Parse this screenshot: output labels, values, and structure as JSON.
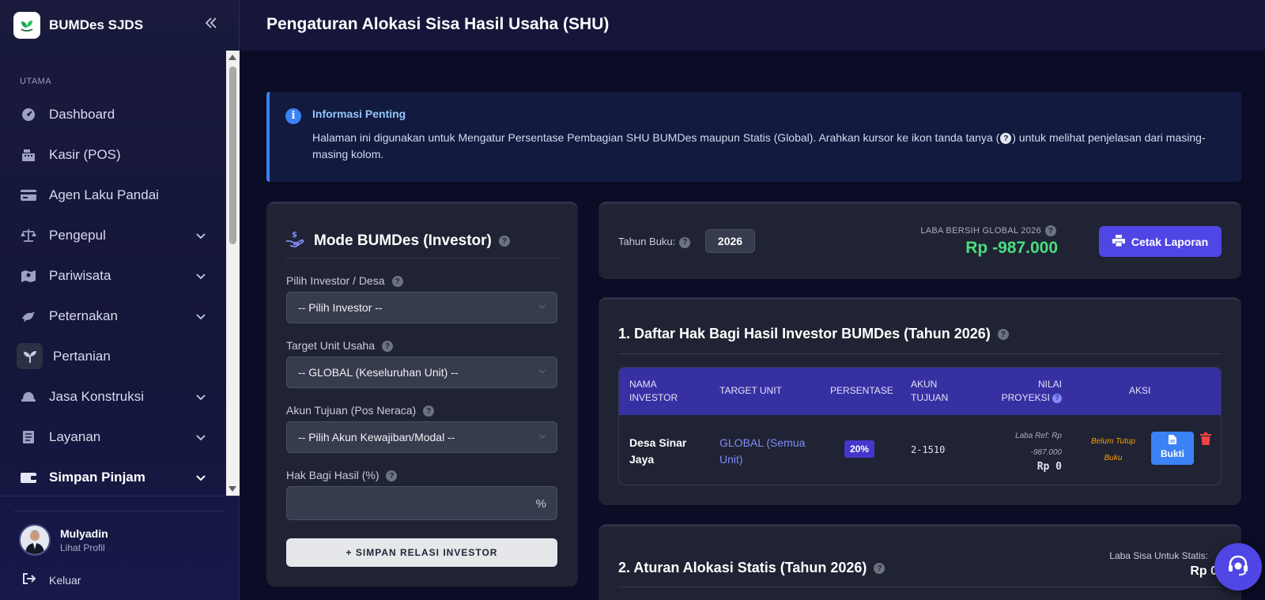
{
  "brand": {
    "name": "BUMDes SJDS"
  },
  "sidebar": {
    "section": "UTAMA",
    "items": [
      {
        "label": "Dashboard",
        "icon": "gauge-icon",
        "chevron": false
      },
      {
        "label": "Kasir (POS)",
        "icon": "cash-register-icon",
        "chevron": false
      },
      {
        "label": "Agen Laku Pandai",
        "icon": "credit-card-icon",
        "chevron": false
      },
      {
        "label": "Pengepul",
        "icon": "scale-icon",
        "chevron": true
      },
      {
        "label": "Pariwisata",
        "icon": "map-icon",
        "chevron": true
      },
      {
        "label": "Peternakan",
        "icon": "bird-icon",
        "chevron": true
      },
      {
        "label": "Pertanian",
        "icon": "seedling-icon",
        "chevron": false
      },
      {
        "label": "Jasa Konstruksi",
        "icon": "helmet-icon",
        "chevron": true
      },
      {
        "label": "Layanan",
        "icon": "document-icon",
        "chevron": true
      },
      {
        "label": "Simpan Pinjam",
        "icon": "wallet-icon",
        "chevron": true
      }
    ],
    "user": {
      "name": "Mulyadin",
      "link": "Lihat Profil"
    },
    "logout": "Keluar"
  },
  "header": {
    "title": "Pengaturan Alokasi Sisa Hasil Usaha (SHU)"
  },
  "alert": {
    "title": "Informasi Penting",
    "body_before": "Halaman ini digunakan untuk Mengatur Persentase Pembagian SHU BUMDes maupun Statis (Global). Arahkan kursor ke ikon tanda tanya (",
    "body_after": ") untuk melihat penjelasan dari masing-masing kolom."
  },
  "form": {
    "title": "Mode BUMDes (Investor)",
    "investor_label": "Pilih Investor / Desa",
    "investor_value": "-- Pilih Investor --",
    "target_label": "Target Unit Usaha",
    "target_value": "-- GLOBAL (Keseluruhan Unit) --",
    "akun_label": "Akun Tujuan (Pos Neraca)",
    "akun_value": "-- Pilih Akun Kewajiban/Modal --",
    "hak_label": "Hak Bagi Hasil (%)",
    "hak_value": "",
    "hak_suffix": "%",
    "save_button": "+ SIMPAN RELASI INVESTOR"
  },
  "summary": {
    "tahun_label": "Tahun Buku:",
    "tahun_value": "2026",
    "laba_label": "LABA BERSIH GLOBAL 2026",
    "laba_value": "Rp -987.000",
    "print_button": "Cetak Laporan"
  },
  "investor_table": {
    "title": "1. Daftar Hak Bagi Hasil Investor BUMDes (Tahun 2026)",
    "headers": {
      "nama": "NAMA INVESTOR",
      "target": "TARGET UNIT",
      "persentase": "PERSENTASE",
      "akun": "AKUN TUJUAN",
      "nilai": "NILAI PROYEKSI",
      "aksi": "AKSI"
    },
    "rows": [
      {
        "nama": "Desa Sinar Jaya",
        "target": "GLOBAL (Semua Unit)",
        "persentase": "20%",
        "akun": "2-1510",
        "laba_ref_1": "Laba Ref: Rp",
        "laba_ref_2": "-987.000",
        "nilai": "Rp 0",
        "status_1": "Belum Tutup",
        "status_2": "Buku",
        "bukti": "Bukti"
      }
    ]
  },
  "static_section": {
    "title": "2. Aturan Alokasi Statis (Tahun 2026)",
    "laba_sisa_label": "Laba Sisa Untuk Statis:",
    "laba_sisa_value": "Rp 0"
  },
  "colors": {
    "accent": "#4f46e5",
    "positive": "#4ade80",
    "info": "#3b82f6",
    "danger": "#ef4444",
    "status_warning": "#f59e0b"
  }
}
